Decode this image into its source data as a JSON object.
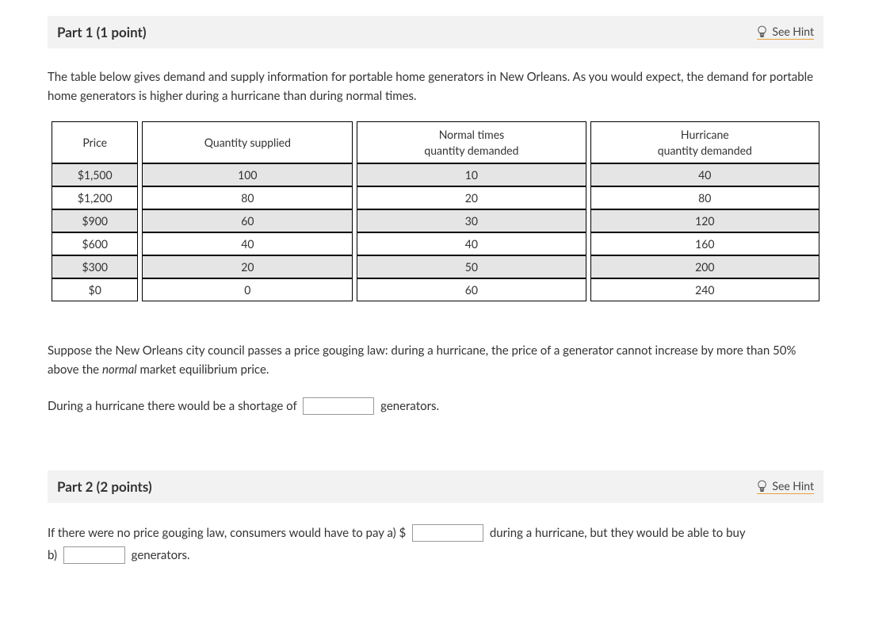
{
  "part1": {
    "title": "Part 1   (1 point)",
    "seeHint": "See Hint",
    "intro": "The table below gives demand and supply information for portable home generators in New Orleans. As you would expect, the demand for portable home generators is higher during a hurricane than during normal times.",
    "headers": {
      "price": "Price",
      "supplied": "Quantity supplied",
      "normal_line1": "Normal times",
      "normal_line2": "quantity demanded",
      "hurricane_line1": "Hurricane",
      "hurricane_line2": "quantity demanded"
    },
    "question_pre": "Suppose the New Orleans city council passes a price gouging law: during a hurricane, the price of a generator cannot increase by more than 50% above the ",
    "question_italic": "normal",
    "question_post": " market equilibrium price.",
    "shortage_pre": "During a hurricane there would be a shortage of ",
    "shortage_post": " generators."
  },
  "part2": {
    "title": "Part 2   (2 points)",
    "seeHint": "See Hint",
    "line_a_pre": "If there were no price gouging law, consumers would have to pay a) $",
    "line_a_post": " during a hurricane, but they would be able to buy",
    "line_b_pre": "b) ",
    "line_b_post": " generators."
  },
  "chart_data": {
    "type": "table",
    "columns": [
      "Price",
      "Quantity supplied",
      "Normal times quantity demanded",
      "Hurricane quantity demanded"
    ],
    "rows": [
      {
        "price": "$1,500",
        "supplied": "100",
        "normal": "10",
        "hurricane": "40"
      },
      {
        "price": "$1,200",
        "supplied": "80",
        "normal": "20",
        "hurricane": "80"
      },
      {
        "price": "$900",
        "supplied": "60",
        "normal": "30",
        "hurricane": "120"
      },
      {
        "price": "$600",
        "supplied": "40",
        "normal": "40",
        "hurricane": "160"
      },
      {
        "price": "$300",
        "supplied": "20",
        "normal": "50",
        "hurricane": "200"
      },
      {
        "price": "$0",
        "supplied": "0",
        "normal": "60",
        "hurricane": "240"
      }
    ]
  }
}
